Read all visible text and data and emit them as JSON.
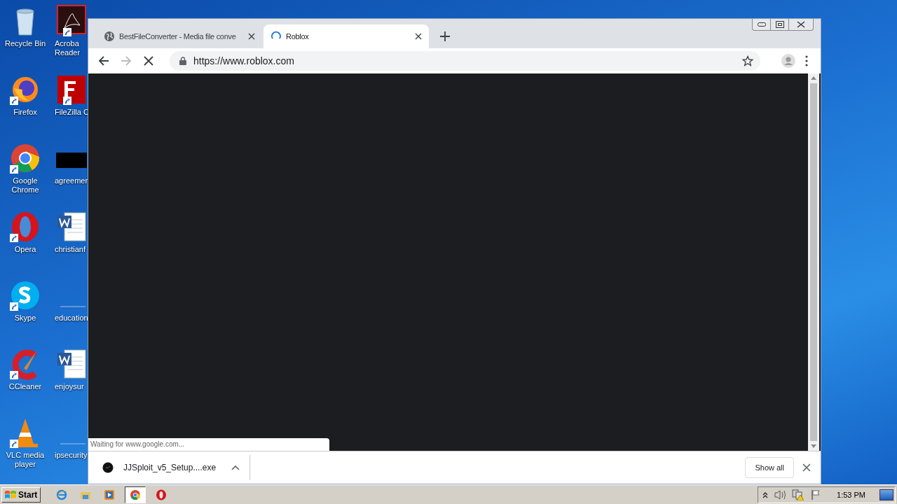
{
  "desktop": {
    "icons": [
      {
        "label": "Recycle Bin",
        "kind": "recycle",
        "shortcut": false
      },
      {
        "label": "Firefox",
        "kind": "firefox",
        "shortcut": true
      },
      {
        "label": "Google Chrome",
        "kind": "chrome",
        "shortcut": true
      },
      {
        "label": "Opera",
        "kind": "opera",
        "shortcut": true
      },
      {
        "label": "Skype",
        "kind": "skype",
        "shortcut": true
      },
      {
        "label": "CCleaner",
        "kind": "ccleaner",
        "shortcut": true
      },
      {
        "label": "VLC media player",
        "kind": "vlc",
        "shortcut": true
      },
      {
        "label": "Acroba Reader",
        "kind": "acrobat",
        "shortcut": true
      },
      {
        "label": "FileZilla C",
        "kind": "filezilla",
        "shortcut": true
      },
      {
        "label": "agreemen",
        "kind": "thumbnail",
        "shortcut": false
      },
      {
        "label": "christianf",
        "kind": "word",
        "shortcut": false
      },
      {
        "label": "education",
        "kind": "blank",
        "shortcut": false
      },
      {
        "label": "enjoysur",
        "kind": "word",
        "shortcut": false
      },
      {
        "label": "ipsecurity",
        "kind": "blank",
        "shortcut": false
      }
    ]
  },
  "browser": {
    "tabs": [
      {
        "title": "BestFileConverter - Media file conve",
        "selected": false,
        "loading": false
      },
      {
        "title": "Roblox",
        "selected": true,
        "loading": true
      }
    ],
    "back_disabled": false,
    "forward_disabled": true,
    "loading": true,
    "url": "https://www.roblox.com",
    "status_text": "Waiting for www.google.com...",
    "downloads": [
      {
        "filename": "JJSploit_v5_Setup....exe"
      }
    ],
    "show_all": "Show all"
  },
  "taskbar": {
    "start": "Start",
    "apps": [
      {
        "kind": "ie",
        "selected": false
      },
      {
        "kind": "explorer",
        "selected": false
      },
      {
        "kind": "media",
        "selected": false
      },
      {
        "kind": "chrome",
        "selected": true
      },
      {
        "kind": "opera",
        "selected": false
      }
    ],
    "time": "1:53 PM"
  }
}
